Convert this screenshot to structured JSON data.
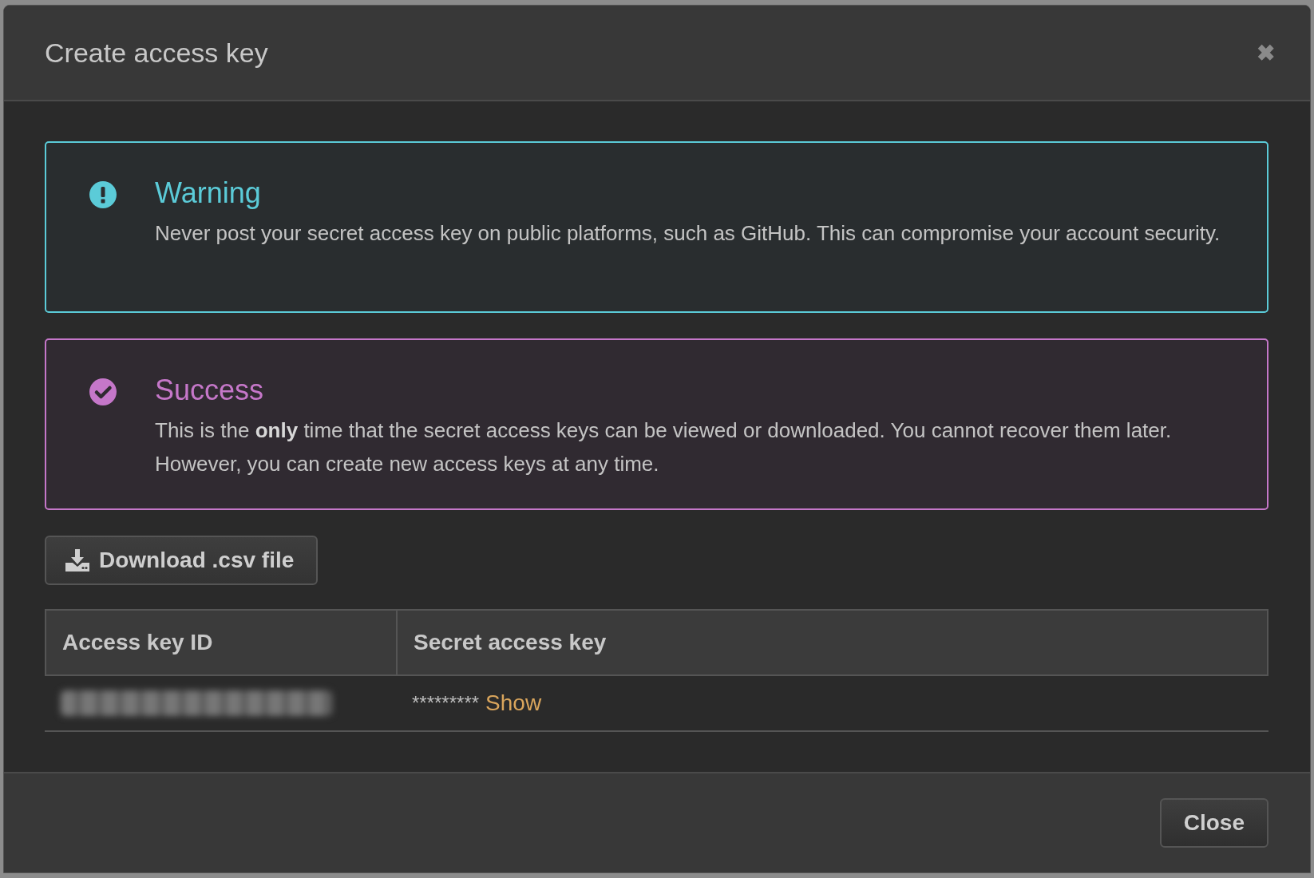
{
  "dialog": {
    "title": "Create access key",
    "close_icon": "✖"
  },
  "alerts": [
    {
      "kind": "warning",
      "title": "Warning",
      "text": "Never post your secret access key on public platforms, such as GitHub. This can compromise your account security."
    },
    {
      "kind": "success",
      "title": "Success",
      "text": "This is the **only** time that the secret access keys can be viewed or downloaded. You cannot recover them later. However, you can create new access keys at any time."
    }
  ],
  "download_button": "Download .csv file",
  "table": {
    "columns": [
      "Access key ID",
      "Secret access key"
    ],
    "rows": [
      {
        "secret_mask": "*********",
        "show_link": "Show"
      }
    ]
  },
  "footer": {
    "close_button": "Close"
  }
}
